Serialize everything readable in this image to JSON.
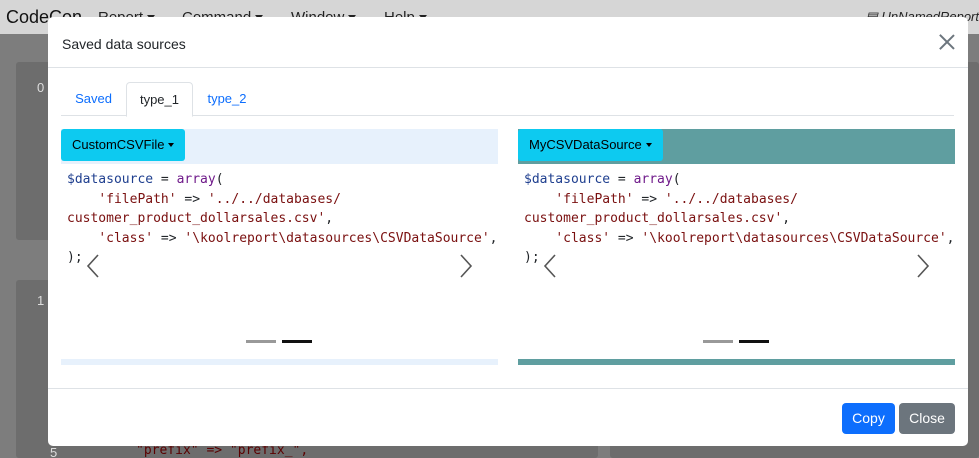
{
  "app": {
    "brand": "CodeCon",
    "menus": [
      "Report",
      "Command",
      "Window",
      "Help"
    ],
    "document_name": "UnNamedReport",
    "gutter_numbers": [
      "0",
      "1",
      "5"
    ],
    "bg_code_line": "\"prefix\" => \"prefix_\","
  },
  "modal": {
    "title": "Saved data sources",
    "tabs": [
      {
        "label": "Saved",
        "active": false
      },
      {
        "label": "type_1",
        "active": true
      },
      {
        "label": "type_2",
        "active": false
      }
    ],
    "panels": [
      {
        "dropdown_label": "CustomCSVFile",
        "header_color": "#e7f1fc",
        "bottom_color": "#e7f1fc",
        "code": {
          "var": "$datasource",
          "fn": "array",
          "file_key": "'filePath'",
          "file_val_1": "'../../databases/",
          "file_val_2": "customer_product_dollarsales.csv'",
          "class_key": "'class'",
          "class_val": "'\\koolreport\\datasources\\CSVDataSource'",
          "closer": ");"
        },
        "active_slide": 2,
        "slide_count": 2
      },
      {
        "dropdown_label": "MyCSVDataSource",
        "header_color": "#5f9ea0",
        "bottom_color": "#5f9ea0",
        "code": {
          "var": "$datasource",
          "fn": "array",
          "file_key": "'filePath'",
          "file_val_1": "'../../databases/",
          "file_val_2": "customer_product_dollarsales.csv'",
          "class_key": "'class'",
          "class_val": "'\\koolreport\\datasources\\CSVDataSource'",
          "closer": ");"
        },
        "active_slide": 2,
        "slide_count": 2
      }
    ],
    "footer": {
      "copy_label": "Copy",
      "close_label": "Close",
      "copy_color": "#0d6efd",
      "close_color": "#6c757d"
    }
  }
}
